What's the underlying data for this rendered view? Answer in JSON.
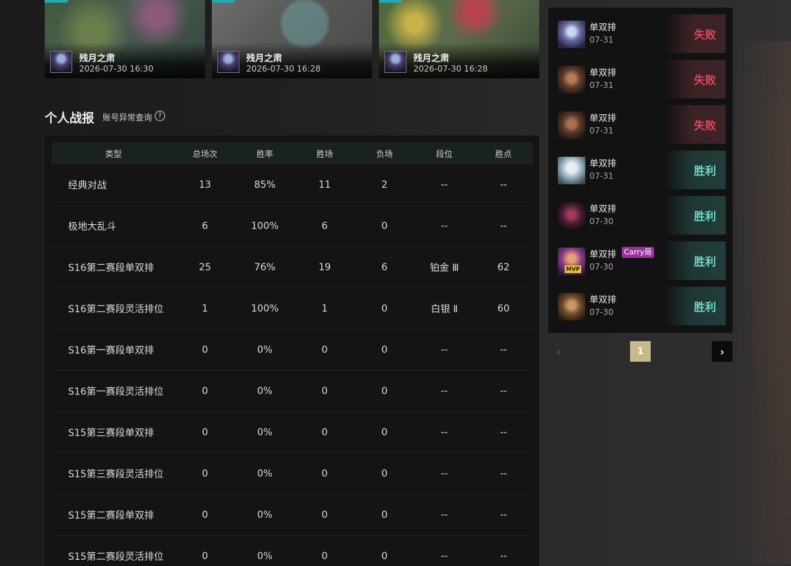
{
  "videos": [
    {
      "player": "残月之肃",
      "time": "2026-07-30 16:30"
    },
    {
      "player": "残月之肃",
      "time": "2026-07-30 16:28"
    },
    {
      "player": "残月之肃",
      "time": "2026-07-30 16:28"
    }
  ],
  "section": {
    "title": "个人战报",
    "link": "账号异常查询",
    "help": "?"
  },
  "table": {
    "headers": [
      "类型",
      "总场次",
      "胜率",
      "胜场",
      "负场",
      "段位",
      "胜点"
    ],
    "rows": [
      [
        "经典对战",
        "13",
        "85%",
        "11",
        "2",
        "--",
        "--"
      ],
      [
        "极地大乱斗",
        "6",
        "100%",
        "6",
        "0",
        "--",
        "--"
      ],
      [
        "S16第二赛段单双排",
        "25",
        "76%",
        "19",
        "6",
        "铂金 Ⅲ",
        "62"
      ],
      [
        "S16第二赛段灵活排位",
        "1",
        "100%",
        "1",
        "0",
        "白银 Ⅱ",
        "60"
      ],
      [
        "S16第一赛段单双排",
        "0",
        "0%",
        "0",
        "0",
        "--",
        "--"
      ],
      [
        "S16第一赛段灵活排位",
        "0",
        "0%",
        "0",
        "0",
        "--",
        "--"
      ],
      [
        "S15第三赛段单双排",
        "0",
        "0%",
        "0",
        "0",
        "--",
        "--"
      ],
      [
        "S15第三赛段灵活排位",
        "0",
        "0%",
        "0",
        "0",
        "--",
        "--"
      ],
      [
        "S15第二赛段单双排",
        "0",
        "0%",
        "0",
        "0",
        "--",
        "--"
      ],
      [
        "S15第二赛段灵活排位",
        "0",
        "0%",
        "0",
        "0",
        "--",
        "--"
      ]
    ]
  },
  "history": [
    {
      "mode": "单双排",
      "date": "07-31",
      "result": "失败",
      "outcome": "lose"
    },
    {
      "mode": "单双排",
      "date": "07-31",
      "result": "失败",
      "outcome": "lose"
    },
    {
      "mode": "单双排",
      "date": "07-31",
      "result": "失败",
      "outcome": "lose"
    },
    {
      "mode": "单双排",
      "date": "07-31",
      "result": "胜利",
      "outcome": "win"
    },
    {
      "mode": "单双排",
      "date": "07-30",
      "result": "胜利",
      "outcome": "win"
    },
    {
      "mode": "单双排",
      "date": "07-30",
      "result": "胜利",
      "outcome": "win",
      "badge": "Carry局",
      "mvp": "MVP"
    },
    {
      "mode": "单双排",
      "date": "07-30",
      "result": "胜利",
      "outcome": "win"
    }
  ],
  "pager": {
    "prev": "‹",
    "current": "1",
    "next": "›"
  },
  "colors": {
    "win": "#6fd8c8",
    "lose": "#e0455a",
    "accent": "#c7b98a"
  }
}
